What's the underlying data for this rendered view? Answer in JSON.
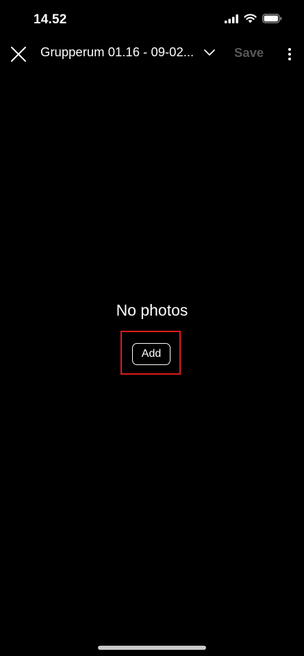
{
  "status_bar": {
    "time": "14.52",
    "icons": [
      "cellular-signal-icon",
      "wifi-icon",
      "battery-icon"
    ]
  },
  "toolbar": {
    "close_icon": "close-icon",
    "title": "Grupperum 01.16 - 09-02...",
    "dropdown_icon": "chevron-down-icon",
    "save_label": "Save",
    "more_icon": "more-vertical-icon"
  },
  "empty_state": {
    "title": "No photos",
    "add_label": "Add"
  },
  "colors": {
    "background": "#000000",
    "text": "#ffffff",
    "disabled_text": "#575757",
    "highlight": "#e11b1b",
    "home_indicator": "#c9c9c9"
  }
}
